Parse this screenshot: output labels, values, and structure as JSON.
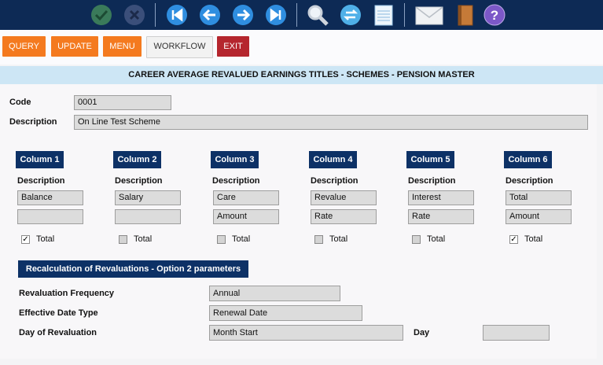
{
  "toolbar": {
    "icons": [
      "check-icon",
      "cancel-icon",
      "first-icon",
      "prev-icon",
      "next-icon",
      "last-icon",
      "search-icon",
      "refresh-icon",
      "notes-icon",
      "mail-icon",
      "book-icon",
      "help-icon"
    ]
  },
  "actions": {
    "query": "QUERY",
    "update": "UPDATE",
    "menu": "MENU",
    "workflow": "WORKFLOW",
    "exit": "EXIT"
  },
  "title": "CAREER AVERAGE REVALUED EARNINGS TITLES - SCHEMES - PENSION MASTER",
  "form": {
    "code_label": "Code",
    "code_value": "0001",
    "description_label": "Description",
    "description_value": "On Line Test Scheme"
  },
  "columns": [
    {
      "header": "Column 1",
      "desc_label": "Description",
      "field1": "Balance",
      "field2": "",
      "total_label": "Total",
      "total_checked": true
    },
    {
      "header": "Column 2",
      "desc_label": "Description",
      "field1": "Salary",
      "field2": "",
      "total_label": "Total",
      "total_checked": false
    },
    {
      "header": "Column 3",
      "desc_label": "Description",
      "field1": "Care",
      "field2": "Amount",
      "total_label": "Total",
      "total_checked": false
    },
    {
      "header": "Column 4",
      "desc_label": "Description",
      "field1": "Revalue",
      "field2": "Rate",
      "total_label": "Total",
      "total_checked": false
    },
    {
      "header": "Column 5",
      "desc_label": "Description",
      "field1": "Interest",
      "field2": "Rate",
      "total_label": "Total",
      "total_checked": false
    },
    {
      "header": "Column 6",
      "desc_label": "Description",
      "field1": "Total",
      "field2": "Amount",
      "total_label": "Total",
      "total_checked": true
    }
  ],
  "recalc": {
    "header": "Recalculation of Revaluations - Option 2 parameters",
    "frequency_label": "Revaluation Frequency",
    "frequency_value": "Annual",
    "date_type_label": "Effective Date Type",
    "date_type_value": "Renewal Date",
    "day_of_revaluation_label": "Day of Revaluation",
    "day_of_revaluation_value": "Month Start",
    "day_label": "Day",
    "day_value": ""
  },
  "colors": {
    "toolbar": "#0d2a55",
    "accent_orange": "#f47a1f",
    "exit_red": "#b5262e",
    "header_navy": "#0d3166",
    "title_bg": "#cde6f5"
  }
}
